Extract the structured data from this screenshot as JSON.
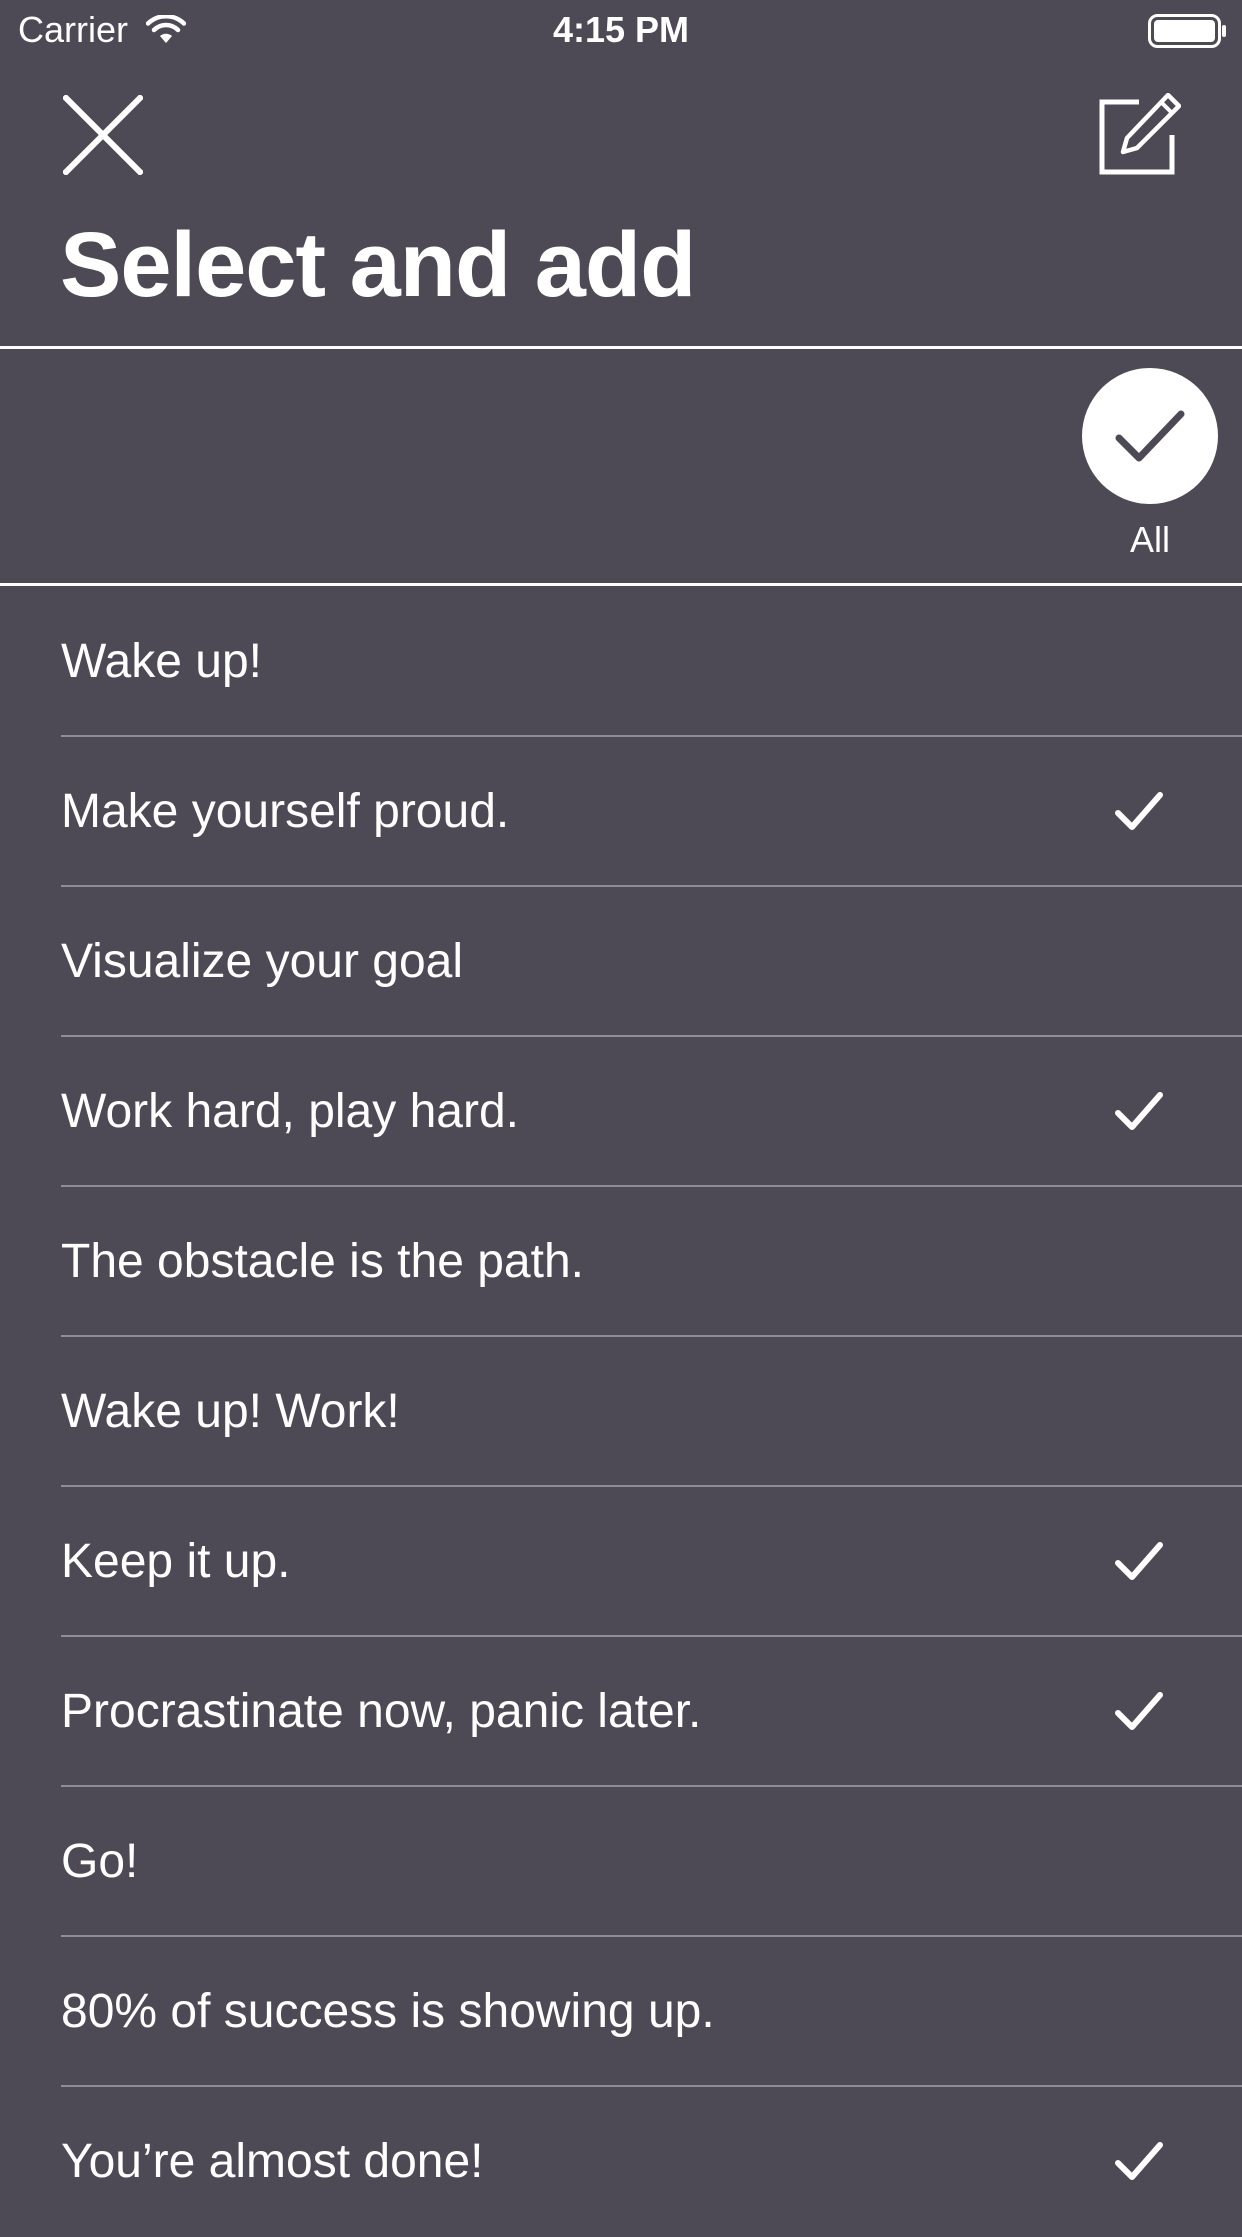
{
  "status_bar": {
    "carrier": "Carrier",
    "time": "4:15 PM"
  },
  "nav": {
    "title": "Select and add"
  },
  "select_all": {
    "label": "All"
  },
  "items": [
    {
      "text": "Wake up!",
      "checked": false
    },
    {
      "text": "Make yourself proud.",
      "checked": true
    },
    {
      "text": "Visualize your goal",
      "checked": false
    },
    {
      "text": "Work hard, play hard.",
      "checked": true
    },
    {
      "text": "The obstacle is the path.",
      "checked": false
    },
    {
      "text": "Wake up! Work!",
      "checked": false
    },
    {
      "text": "Keep it up.",
      "checked": true
    },
    {
      "text": "Procrastinate now, panic later.",
      "checked": true
    },
    {
      "text": "Go!",
      "checked": false
    },
    {
      "text": "80% of success is showing up.",
      "checked": false
    },
    {
      "text": "You’re almost done!",
      "checked": true
    }
  ],
  "colors": {
    "background": "#4d4a55",
    "foreground": "#ffffff",
    "separator": "#8e8c95"
  }
}
